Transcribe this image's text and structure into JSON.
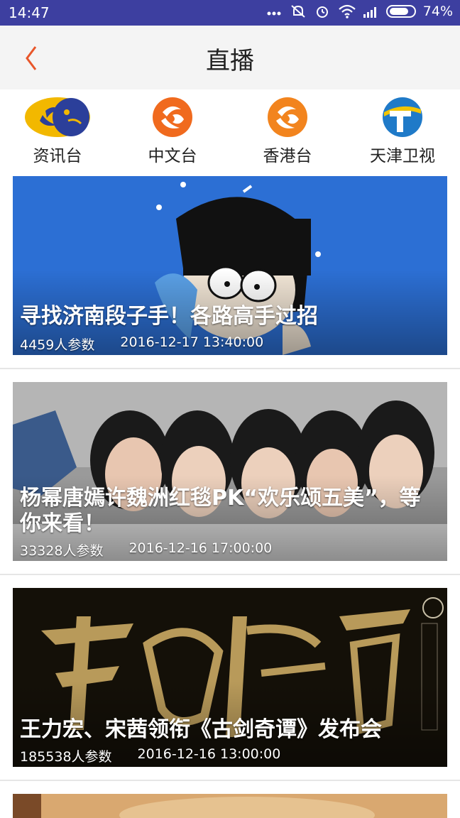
{
  "status_bar": {
    "time": "14:47",
    "battery": "74%",
    "icons": [
      "more-dots-icon",
      "mute-bell-icon",
      "alarm-icon",
      "wifi-icon",
      "signal-icon",
      "battery-icon"
    ]
  },
  "header": {
    "title": "直播",
    "back_icon": "chevron-left-icon",
    "accent": "#e8562a"
  },
  "channels": [
    {
      "label": "资讯台",
      "icon": "phoenix-info-logo"
    },
    {
      "label": "中文台",
      "icon": "phoenix-chinese-logo"
    },
    {
      "label": "香港台",
      "icon": "phoenix-hk-logo"
    },
    {
      "label": "天津卫视",
      "icon": "tianjin-tv-logo"
    }
  ],
  "feed": [
    {
      "title": "寻找济南段子手！各路高手过招",
      "participants": "4459人参数",
      "datetime": "2016-12-17 13:40:00"
    },
    {
      "title": "杨幂唐嫣许魏洲红毯PK“欢乐颂五美”，等你来看！",
      "participants": "33328人参数",
      "datetime": "2016-12-16 17:00:00"
    },
    {
      "title": "王力宏、宋茜领衔《古剑奇谭》发布会",
      "participants": "185538人参数",
      "datetime": "2016-12-16 13:00:00"
    }
  ]
}
